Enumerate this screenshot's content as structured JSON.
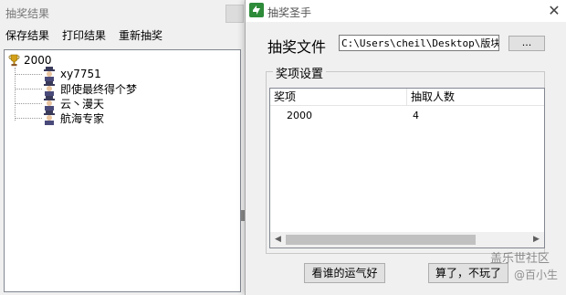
{
  "results_window": {
    "title": "抽奖结果",
    "menu": [
      "保存结果",
      "打印结果",
      "重新抽奖"
    ],
    "tree": {
      "root": "2000",
      "children": [
        "xy7751",
        "即使最终得个梦",
        "云丶漫天",
        "航海专家"
      ]
    }
  },
  "dialog": {
    "title": "抽奖圣手",
    "file_label": "抽奖文件",
    "file_path": "C:\\Users\\cheil\\Desktop\\版块活",
    "browse_label": "...",
    "group_title": "奖项设置",
    "columns": [
      "奖项",
      "抽取人数"
    ],
    "rows": [
      {
        "prize": "2000",
        "count": "4"
      }
    ],
    "buttons": {
      "lucky": "看谁的运气好",
      "quit": "算了，不玩了"
    }
  },
  "watermark": {
    "site": "盖乐世社区",
    "author": "@百小生"
  },
  "colors": {
    "tree_line": "#999999",
    "trophy": "#d4a017",
    "app_icon": "#2e8b3a"
  }
}
